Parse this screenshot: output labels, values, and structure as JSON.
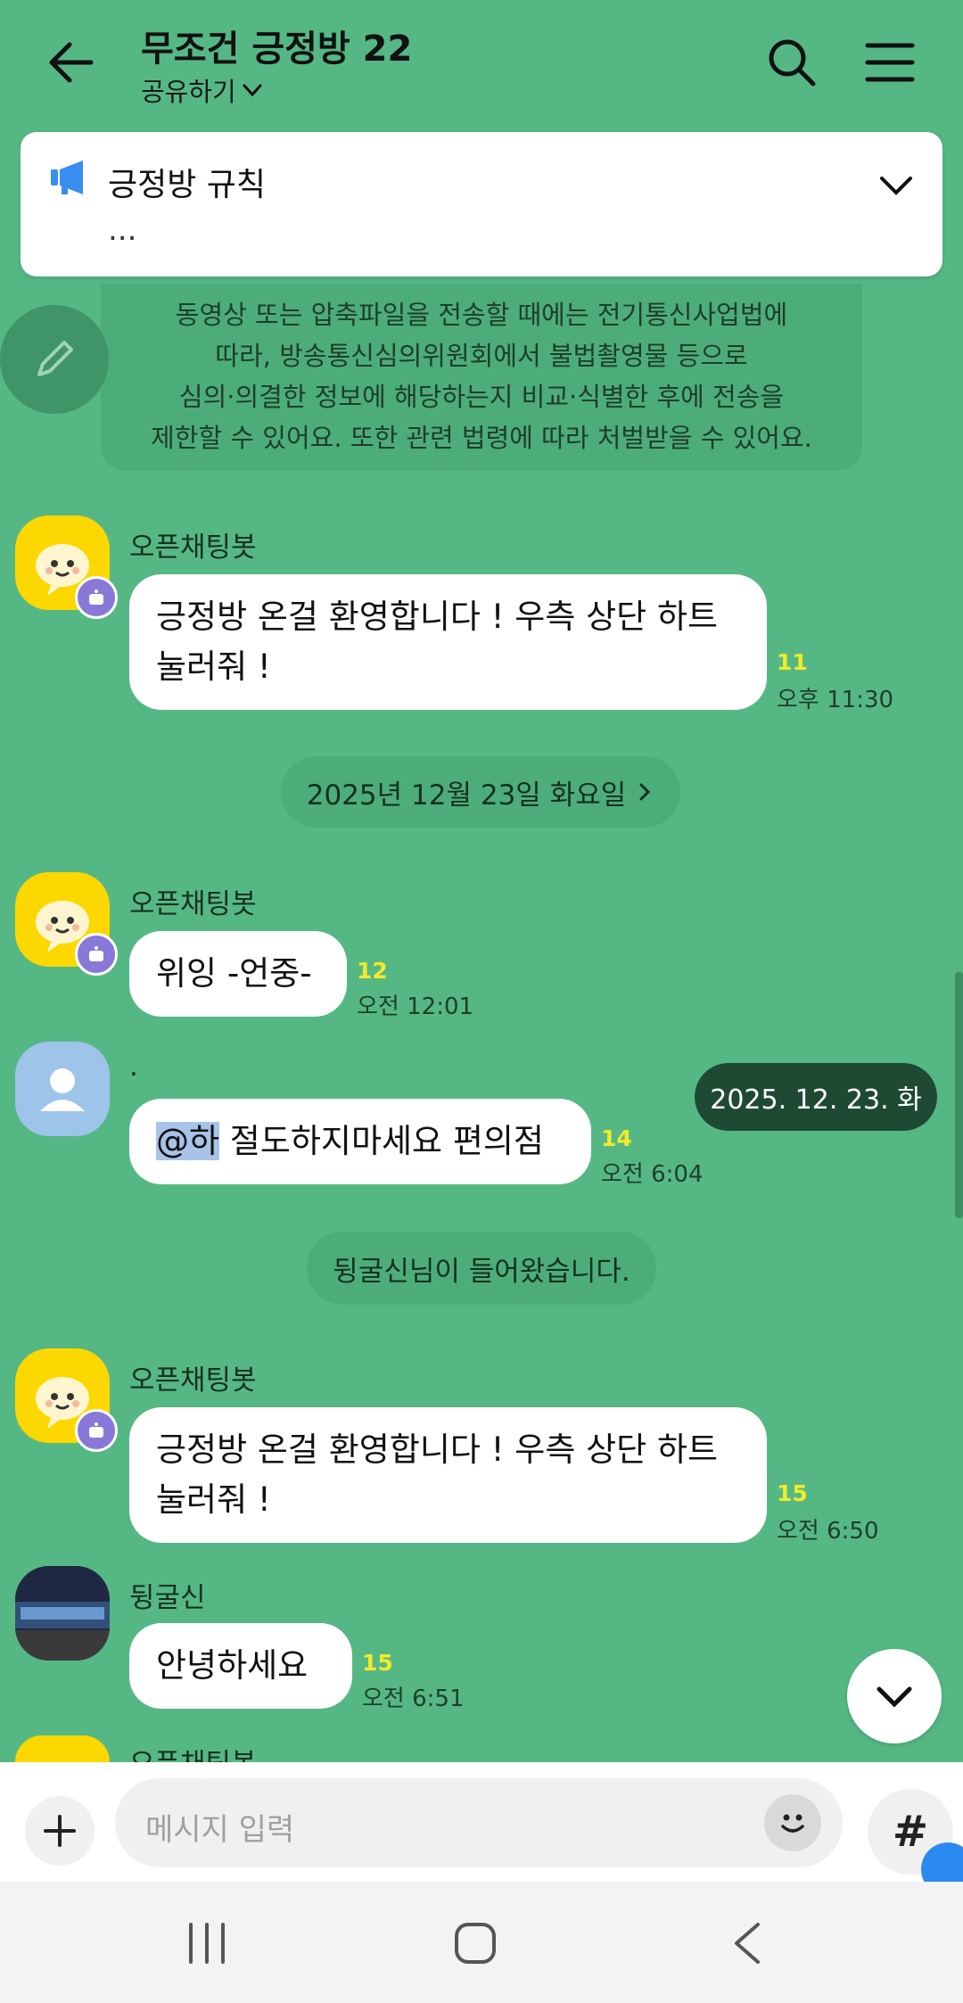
{
  "header": {
    "title": "무조건 긍정방 22",
    "share_label": "공유하기",
    "icons": [
      "back-arrow-icon",
      "search-icon",
      "menu-icon"
    ]
  },
  "notice": {
    "icon": "megaphone-icon",
    "title": "긍정방 규칙",
    "preview": "...",
    "accent": "#3a8ef0"
  },
  "system_notice": {
    "lines": [
      "동영상 또는 압축파일을 전송할 때에는 전기통신사업법에",
      "따라, 방송통신심의위원회에서 불법촬영물 등으로",
      "심의·의결한 정보에 해당하는지 비교·식별한 후에 전송을",
      "제한할 수 있어요. 또한 관련 법령에 따라 처벌받을 수 있어요."
    ]
  },
  "messages": [
    {
      "sender": "오픈채팅봇",
      "lines": [
        "긍정방 온걸 환영합니다 ! 우측 상단 하트",
        "눌러줘 !"
      ],
      "count": "11",
      "time": "오후 11:30"
    },
    {
      "sender": "오픈채팅봇",
      "lines": [
        "위잉 -언중-"
      ],
      "count": "12",
      "time": "오전 12:01"
    },
    {
      "sender": ".",
      "mention": "@하",
      "text": " 절도하지마세요 편의점",
      "count": "14",
      "time": "오전 6:04"
    },
    {
      "sender": "오픈채팅봇",
      "lines": [
        "긍정방 온걸 환영합니다 ! 우측 상단 하트",
        "눌러줘 !"
      ],
      "count": "15",
      "time": "오전 6:50"
    },
    {
      "sender": "뒹굴신",
      "lines": [
        "안녕하세요"
      ],
      "count": "15",
      "time": "오전 6:51"
    },
    {
      "sender": "오픈채팅봇"
    }
  ],
  "date_divider": "2025년 12월 23일 화요일",
  "date_float": "2025. 12. 23. 화",
  "join_notice": "뒹굴신님이 들어왔습니다.",
  "input": {
    "placeholder": "메시지 입력",
    "hash_label": "#"
  },
  "colors": {
    "background": "#55b884",
    "count": "#f3ea2a",
    "bot_avatar": "#fcd800"
  }
}
